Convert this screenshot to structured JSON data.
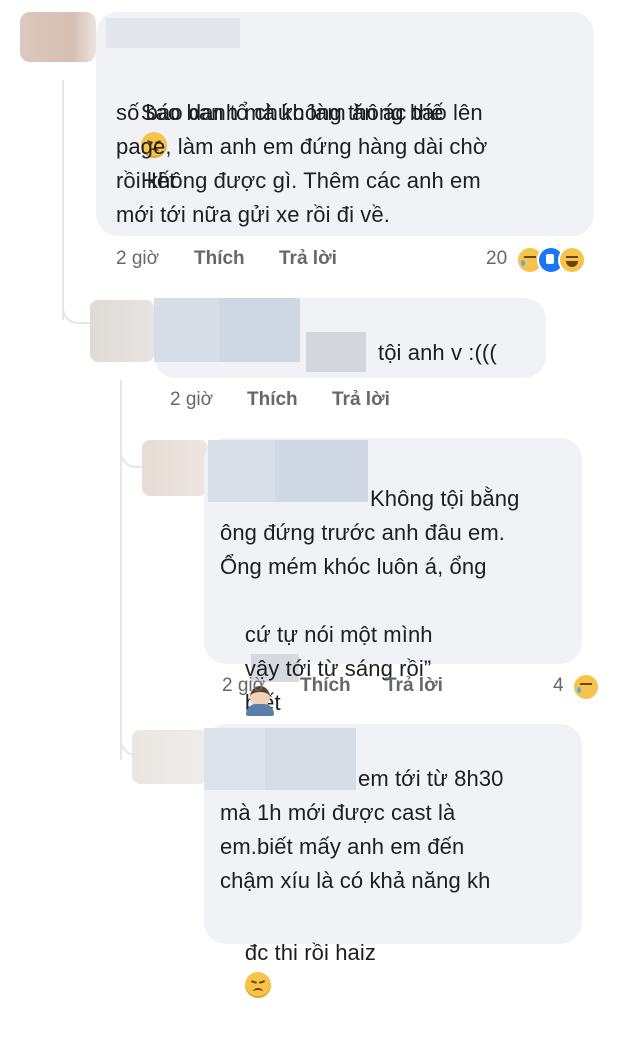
{
  "comments": [
    {
      "lines": [
        "Sao ban tổ chức làm ăn ác thế",
        "số báo danh mà không thông báo lên",
        "page, làm anh em đứng hàng dài chờ",
        "rồi không được gì. Thêm các anh em",
        "mới tới nữa gửi xe rồi đi về."
      ],
      "line1_tail": "Hết",
      "time": "2 giờ",
      "like_label": "Thích",
      "reply_label": "Trả lời",
      "reaction_count": "20"
    },
    {
      "lines": [
        "tội anh v :((("
      ],
      "time": "2 giờ",
      "like_label": "Thích",
      "reply_label": "Trả lời"
    },
    {
      "lines": [
        "Không tội bằng",
        "ông đứng trước anh đâu em.",
        "Ổng mém khóc luôn á, ổng",
        "cứ tự nói một mình",
        "vậy tới từ sáng rồi”"
      ],
      "line4_tail": "biết",
      "time": "2 giờ",
      "like_label": "Thích",
      "reply_label": "Trả lời",
      "reaction_count": "4"
    },
    {
      "lines": [
        "em tới từ 8h30",
        "mà 1h mới được cast là",
        "em.biết mấy anh em đến",
        "chậm xíu là có khả năng kh",
        "đc thi rồi haiz"
      ]
    }
  ],
  "colors": {
    "bubble": "#f0f2f5",
    "meta_text": "#65676b",
    "thread_line": "#e4e6eb"
  },
  "icons": [
    "sad-emoji-icon",
    "like-reaction-icon",
    "haha-reaction-icon",
    "facepalm-emoji-icon"
  ]
}
